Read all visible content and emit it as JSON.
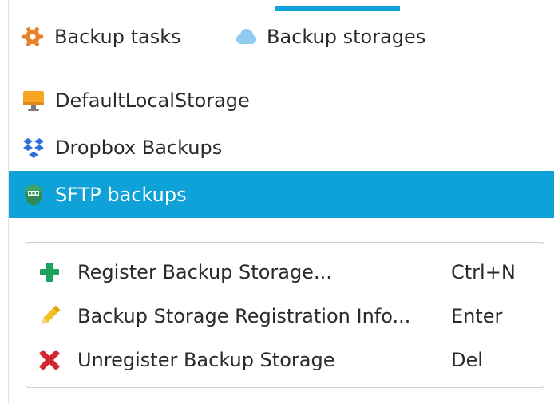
{
  "tabs": [
    {
      "label": "Backup tasks",
      "icon": "gear-icon",
      "icon_color": "#e8812a",
      "selected": false
    },
    {
      "label": "Backup storages",
      "icon": "cloud-icon",
      "icon_color": "#8ecbef",
      "selected": true
    }
  ],
  "accent_color": "#0ea2d8",
  "storages": [
    {
      "label": "DefaultLocalStorage",
      "icon": "monitor-icon",
      "selected": false
    },
    {
      "label": "Dropbox Backups",
      "icon": "dropbox-icon",
      "selected": false
    },
    {
      "label": "SFTP backups",
      "icon": "sftp-shield-icon",
      "selected": true
    }
  ],
  "context_menu": {
    "items": [
      {
        "label": "Register Backup Storage...",
        "shortcut": "Ctrl+N",
        "icon": "plus-icon",
        "icon_color": "#1aa35c"
      },
      {
        "label": "Backup Storage Registration Info...",
        "shortcut": "Enter",
        "icon": "pencil-icon",
        "icon_color": "#f2c024"
      },
      {
        "label": "Unregister Backup Storage",
        "shortcut": "Del",
        "icon": "close-icon",
        "icon_color": "#d0282f"
      }
    ]
  }
}
